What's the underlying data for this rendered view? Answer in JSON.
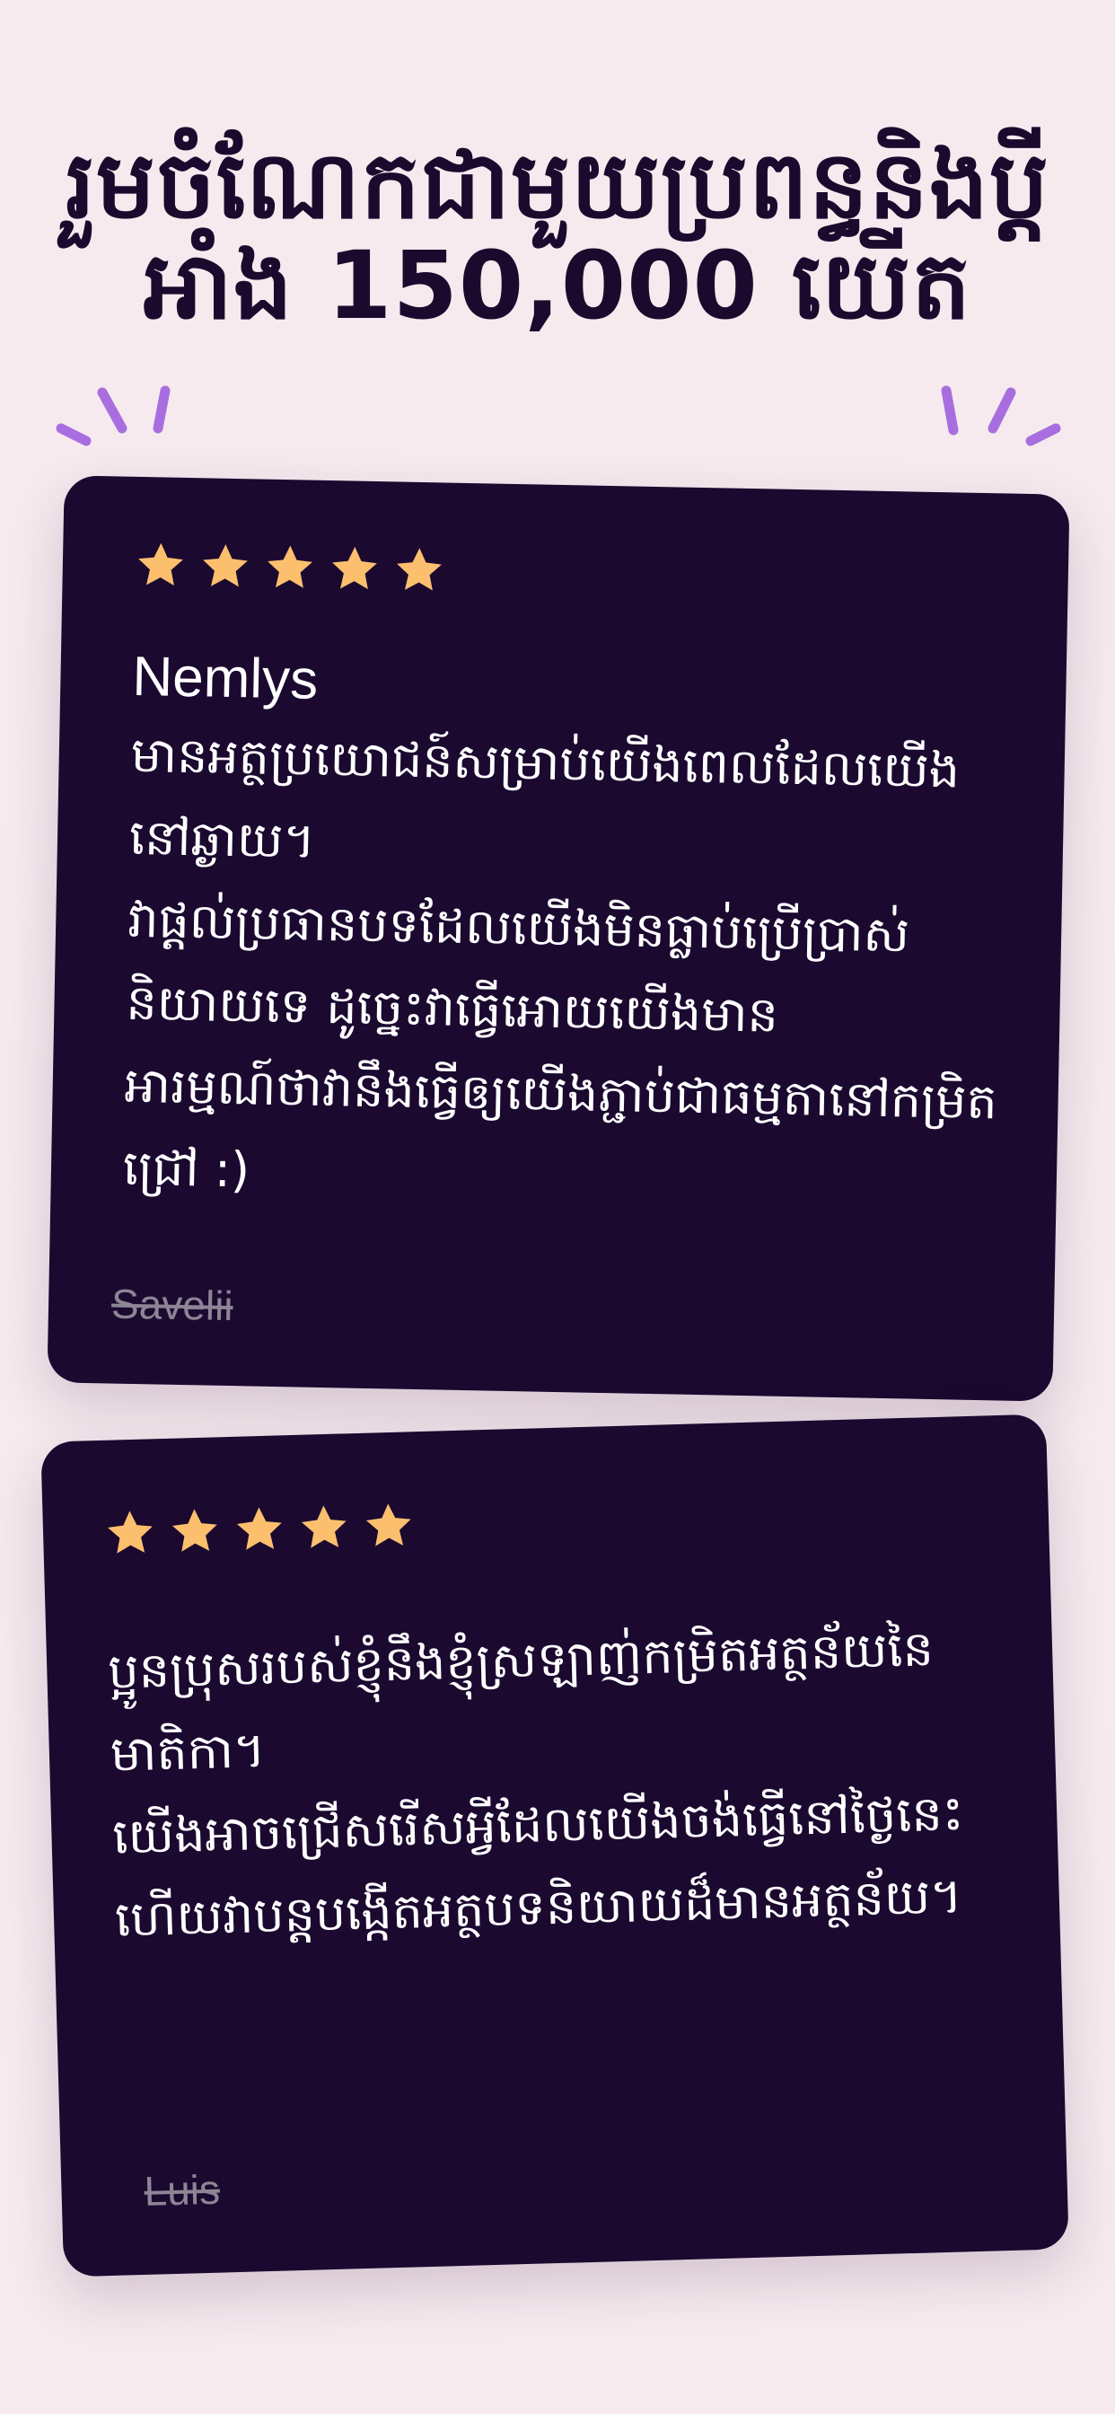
{
  "headline": "រួមចំណែកជាមួយប្រពន្ធនិងប្តីអាំង 150,000 យើត",
  "colors": {
    "background": "#f6eaee",
    "card": "#1b0930",
    "headline": "#1c0a2e",
    "star": "#fbbf6e",
    "sparkle": "#a86ee0",
    "author": "#8d8496"
  },
  "reviews": [
    {
      "rating": 5,
      "title": "Nemlys",
      "body": "មានអត្ថប្រយោជន៍សម្រាប់យើងពេលដែលយើងនៅឆ្ងាយ។\nវាផ្តល់ប្រធានបទដែលយើងមិនធ្លាប់ប្រើប្រាស់និយាយទេ ដូច្នេះវាធ្វើអោយយើងមានអារម្មណ៍ថាវានឹងធ្វើឲ្យយើងភ្ជាប់ជាធម្មតានៅកម្រិតជ្រៅ :)",
      "author": "Savelii"
    },
    {
      "rating": 5,
      "title": "",
      "body": "ប្អូនប្រុសរបស់ខ្ញុំនឹងខ្ញុំស្រឡាញ់កម្រិតអត្ថន័យនៃមាតិកា។\nយើងអាចជ្រើសរើសអ្វីដែលយើងចង់ធ្វើនៅថ្ងៃនេះ\nហើយវាបន្តបង្កើតអត្ថបទនិយាយដ៏មានអត្ថន័យ។",
      "author": "Luis"
    }
  ]
}
